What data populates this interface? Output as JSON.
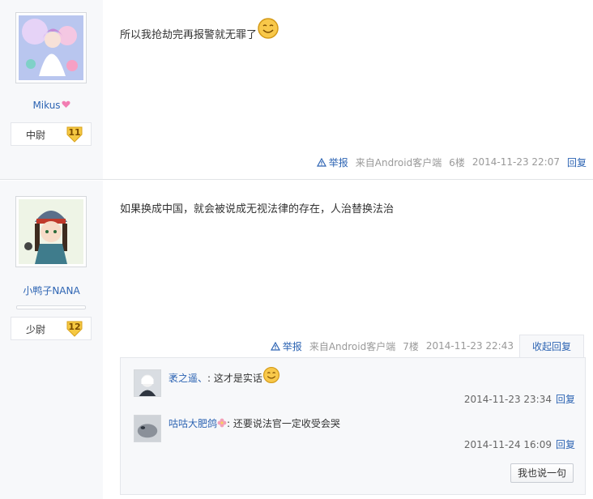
{
  "posts": [
    {
      "user": {
        "name": "Mikus",
        "rank": "中尉",
        "level": "11"
      },
      "content": "所以我抢劫完再报警就无罪了",
      "tail": {
        "report": "举报",
        "source": "来自Android客户端",
        "floor": "6楼",
        "time": "2014-11-23 22:07",
        "reply": "回复"
      }
    },
    {
      "user": {
        "name": "小鸭子NANA",
        "rank": "少尉",
        "level": "12"
      },
      "content": "如果换成中国，就会被说成无视法律的存在，人治替换法治",
      "tail": {
        "report": "举报",
        "source": "来自Android客户端",
        "floor": "7楼",
        "time": "2014-11-23 22:43",
        "fold": "收起回复"
      },
      "replies": [
        {
          "user": "袤之遥、",
          "sep": ":",
          "text": "这才是实话",
          "time": "2014-11-23 23:34",
          "reply": "回复"
        },
        {
          "user": "咕咕大肥鸽",
          "sep": ":",
          "text": "还要说法官一定收受会哭",
          "time": "2014-11-24 16:09",
          "reply": "回复"
        }
      ],
      "say_button": "我也说一句"
    }
  ],
  "colors": {
    "link": "#2d64b3",
    "sidebar": "#f7f8fa",
    "badge": "#f5c842"
  },
  "icons": [
    "smile-emoticon-icon",
    "warning-triangle-icon",
    "heart-icon",
    "flower-icon",
    "level-badge-icon"
  ]
}
